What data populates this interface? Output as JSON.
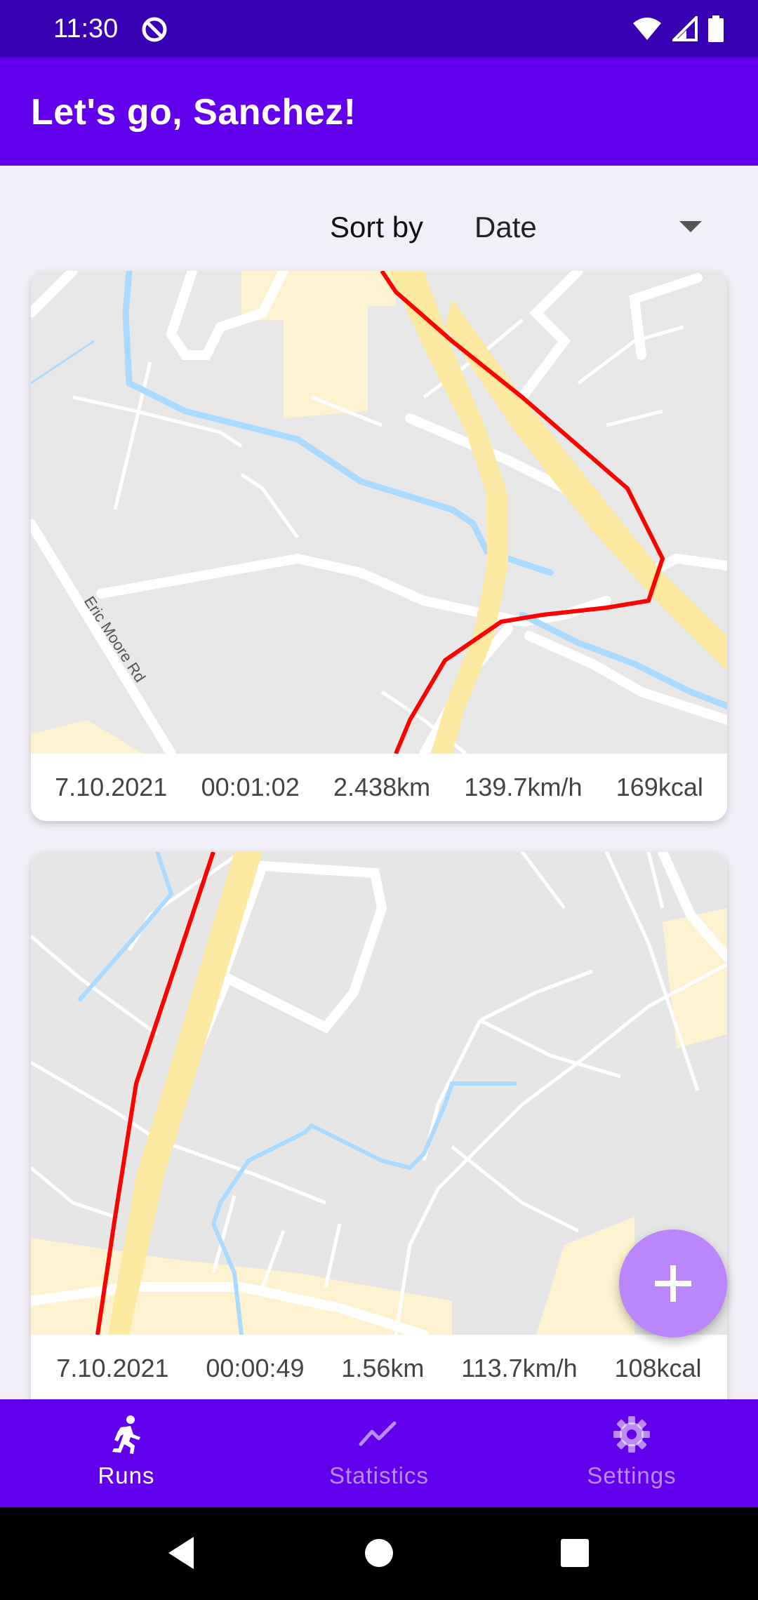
{
  "status_bar": {
    "time": "11:30",
    "icons": [
      "no-sync-icon",
      "wifi-icon",
      "signal-icon",
      "battery-icon"
    ]
  },
  "app_bar": {
    "title": "Let's go, Sanchez!"
  },
  "sort": {
    "label": "Sort by",
    "selected": "Date"
  },
  "runs": [
    {
      "date": "7.10.2021",
      "duration": "00:01:02",
      "distance": "2.438km",
      "speed": "139.7km/h",
      "calories": "169kcal",
      "map_label": "Eric Moore Rd"
    },
    {
      "date": "7.10.2021",
      "duration": "00:00:49",
      "distance": "1.56km",
      "speed": "113.7km/h",
      "calories": "108kcal"
    }
  ],
  "fab": {
    "icon": "plus-icon"
  },
  "bottom_nav": [
    {
      "label": "Runs",
      "icon": "run-icon",
      "active": true
    },
    {
      "label": "Statistics",
      "icon": "chart-line-icon",
      "active": false
    },
    {
      "label": "Settings",
      "icon": "gear-icon",
      "active": false
    }
  ],
  "system_nav": {
    "icons": [
      "back-icon",
      "home-icon",
      "recents-icon"
    ]
  },
  "colors": {
    "primary": "#6200ee",
    "primary_dark": "#3700b3",
    "accent": "#bb86fc",
    "route": "#ff0000"
  }
}
